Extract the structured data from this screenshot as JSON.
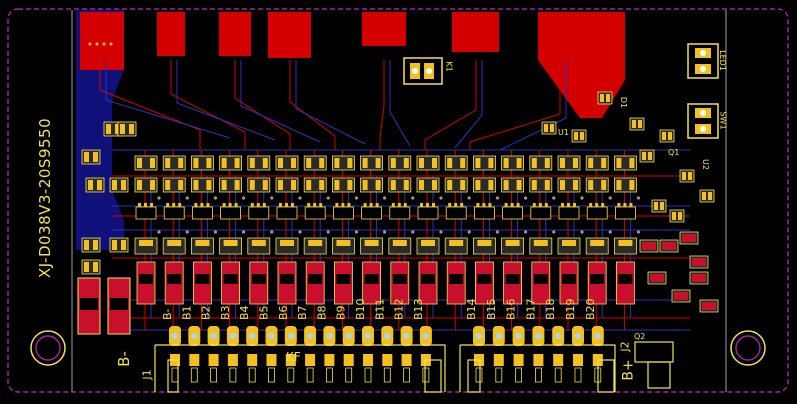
{
  "board_text": {
    "model": "XJ-D038V3-20S9550",
    "b_minus": "B-",
    "b_plus": "B+",
    "j1": "J1",
    "j2": "J2",
    "kf": "KF",
    "k1": "K1",
    "sw1": "SW1",
    "led1": "LED1",
    "q1": "Q1",
    "q2": "Q2",
    "d1": "D1",
    "u1": "U1",
    "u2": "U2"
  },
  "balance_pins_left": [
    "B-",
    "B1",
    "B2",
    "B3",
    "B4",
    "B5",
    "B6",
    "B7",
    "B8",
    "B9",
    "B10",
    "B11",
    "B12",
    "B13"
  ],
  "balance_pins_right": [
    "B14",
    "B15",
    "B16",
    "B17",
    "B18",
    "B19",
    "B20"
  ],
  "colors": {
    "background": "#000000",
    "copper_top": "#d40000",
    "copper_bottom": "#10107a",
    "silkscreen": "#f3e34c",
    "pad": "#f4c020",
    "via": "#9a9a9a",
    "outline": "#a020a0"
  }
}
